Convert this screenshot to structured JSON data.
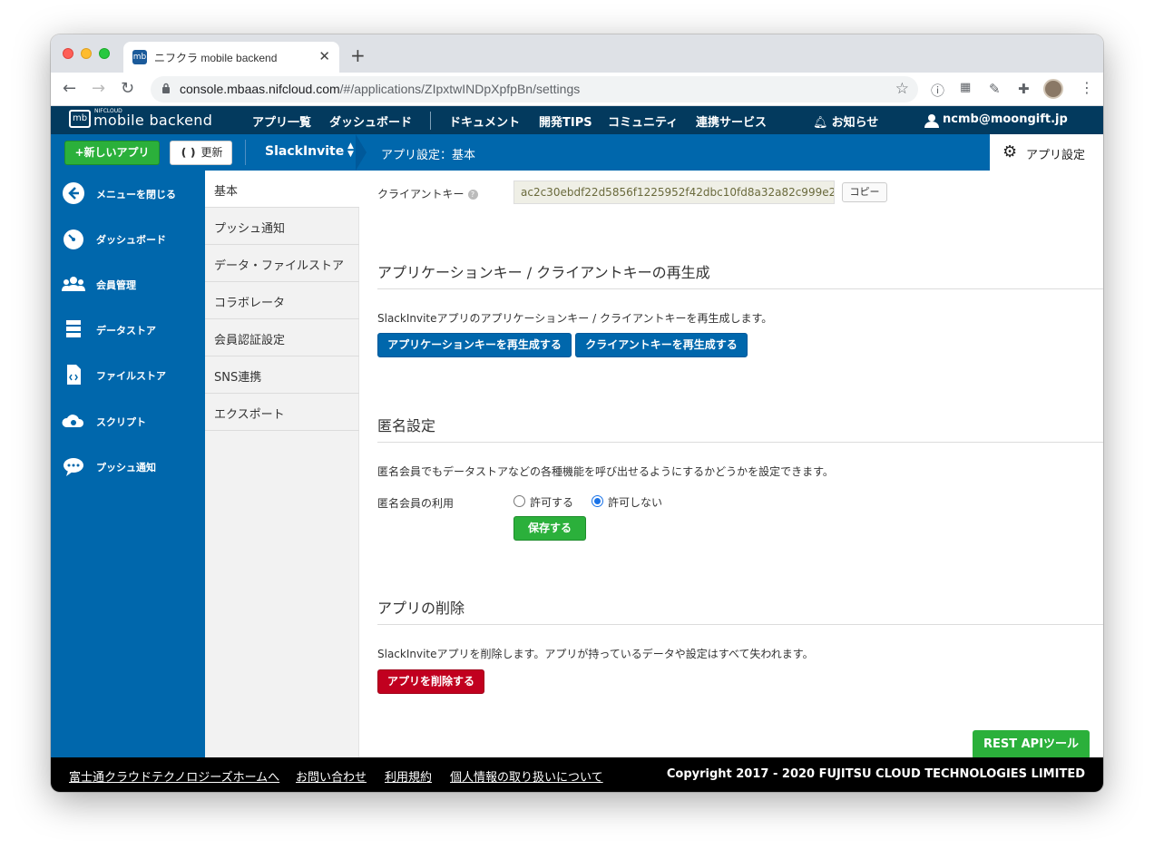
{
  "browser": {
    "tab_title": "ニフクラ mobile backend",
    "tab_favicon": "mb",
    "url_host": "console.mbaas.nifcloud.com",
    "url_path": "/#/applications/ZIpxtwINDpXpfpBn/settings"
  },
  "appbar": {
    "logo_small": "NIFCLOUD",
    "logo_box": "mb",
    "logo_text": "mobile backend",
    "nav": [
      "アプリ一覧",
      "ダッシュボード",
      "ドキュメント",
      "開発TIPS",
      "コミュニティ",
      "連携サービス"
    ],
    "notifications": "お知らせ",
    "user": "ncmb@moongift.jp"
  },
  "bluebar": {
    "new_app": "+新しいアプリ",
    "refresh": "更新",
    "app_name": "SlackInvite",
    "breadcrumb": "アプリ設定：基本",
    "settings": "アプリ設定"
  },
  "sidebar": {
    "items": [
      {
        "label": "メニューを閉じる",
        "icon": "arrow-left-circle-icon"
      },
      {
        "label": "ダッシュボード",
        "icon": "gauge-icon"
      },
      {
        "label": "会員管理",
        "icon": "users-icon"
      },
      {
        "label": "データストア",
        "icon": "database-icon"
      },
      {
        "label": "ファイルストア",
        "icon": "file-code-icon"
      },
      {
        "label": "スクリプト",
        "icon": "cloud-gear-icon"
      },
      {
        "label": "プッシュ通知",
        "icon": "chat-bubble-icon"
      }
    ]
  },
  "submenu": {
    "items": [
      "基本",
      "プッシュ通知",
      "データ・ファイルストア",
      "コラボレータ",
      "会員認証設定",
      "SNS連携",
      "エクスポート"
    ]
  },
  "content": {
    "client_key_label": "クライアントキー",
    "client_key_value": "ac2c30ebdf22d5856f1225952f42dbc10fd8a32a82c999e2",
    "copy": "コピー",
    "regen_title": "アプリケーションキー / クライアントキーの再生成",
    "regen_desc": "SlackInviteアプリのアプリケーションキー / クライアントキーを再生成します。",
    "regen_app_btn": "アプリケーションキーを再生成する",
    "regen_client_btn": "クライアントキーを再生成する",
    "anon_title": "匿名設定",
    "anon_desc": "匿名会員でもデータストアなどの各種機能を呼び出せるようにするかどうかを設定できます。",
    "anon_label": "匿名会員の利用",
    "anon_allow": "許可する",
    "anon_deny": "許可しない",
    "anon_selected": "許可しない",
    "save": "保存する",
    "delete_title": "アプリの削除",
    "delete_desc": "SlackInviteアプリを削除します。アプリが持っているデータや設定はすべて失われます。",
    "delete_btn": "アプリを削除する",
    "rest_tool": "REST APIツール"
  },
  "footer": {
    "links": [
      "富士通クラウドテクノロジーズホームへ",
      "お問い合わせ",
      "利用規約",
      "個人情報の取り扱いについて"
    ],
    "copyright": "Copyright 2017 - 2020 FUJITSU CLOUD TECHNOLOGIES LIMITED"
  },
  "colors": {
    "header_dark": "#033a5e",
    "primary_blue": "#0067ac",
    "green": "#2bb03b",
    "danger_red": "#c1001f"
  }
}
